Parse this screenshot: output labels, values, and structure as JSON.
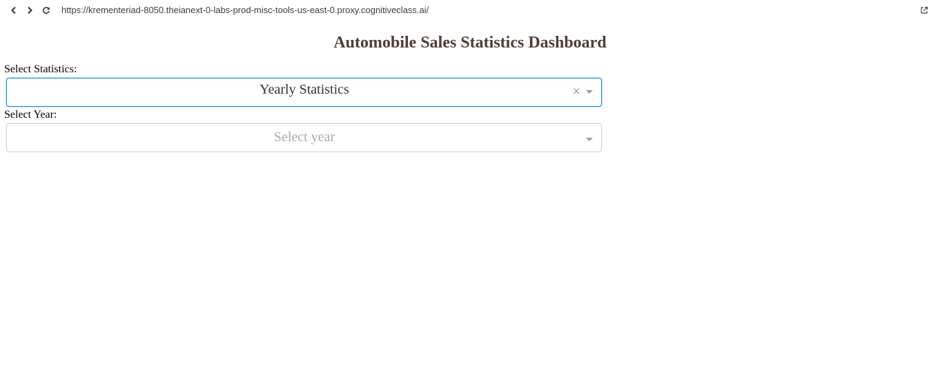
{
  "browser": {
    "url": "https://krementeriad-8050.theianext-0-labs-prod-misc-tools-us-east-0.proxy.cognitiveclass.ai/",
    "icons": [
      "chevron-left-icon",
      "chevron-right-icon",
      "reload-icon",
      "open-external-icon"
    ]
  },
  "page": {
    "title": "Automobile Sales Statistics Dashboard",
    "title_color": "#503D36"
  },
  "statistics_select": {
    "label": "Select Statistics:",
    "value": "Yearly Statistics",
    "clear_symbol": "×",
    "focused": true,
    "focus_color": "#0c91d1"
  },
  "year_select": {
    "label": "Select Year:",
    "placeholder": "Select year",
    "value": ""
  }
}
